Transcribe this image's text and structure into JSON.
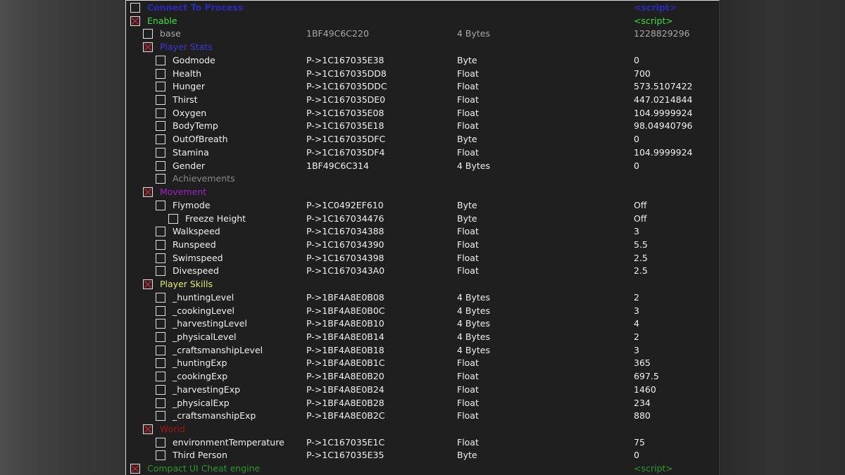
{
  "cheat_table": {
    "rows": [
      {
        "level": 0,
        "checked": false,
        "description": "Connect To Process",
        "address": "",
        "type": "",
        "value": "<script>",
        "desc_color": "#2a2ab8",
        "value_color": "#2a2ab8"
      },
      {
        "level": 0,
        "checked": true,
        "description": "Enable",
        "address": "",
        "type": "",
        "value": "<script>",
        "desc_color": "#3ce03c",
        "value_color": "#3ce03c"
      },
      {
        "level": 1,
        "checked": false,
        "description": "base",
        "address": "1BF49C6C220",
        "type": "4 Bytes",
        "value": "1228829296",
        "desc_color": "#a8a8a8",
        "value_color": "#a8a8a8",
        "addr_color": "#a8a8a8",
        "type_color": "#a8a8a8"
      },
      {
        "level": 1,
        "checked": true,
        "description": "Player Stats",
        "address": "",
        "type": "",
        "value": "",
        "desc_color": "#3a3ad8"
      },
      {
        "level": 2,
        "checked": false,
        "description": "Godmode",
        "address": "P->1C167035E38",
        "type": "Byte",
        "value": "0"
      },
      {
        "level": 2,
        "checked": false,
        "description": "Health",
        "address": "P->1C167035DD8",
        "type": "Float",
        "value": "700"
      },
      {
        "level": 2,
        "checked": false,
        "description": "Hunger",
        "address": "P->1C167035DDC",
        "type": "Float",
        "value": "573.5107422"
      },
      {
        "level": 2,
        "checked": false,
        "description": "Thirst",
        "address": "P->1C167035DE0",
        "type": "Float",
        "value": "447.0214844"
      },
      {
        "level": 2,
        "checked": false,
        "description": "Oxygen",
        "address": "P->1C167035E08",
        "type": "Float",
        "value": "104.9999924"
      },
      {
        "level": 2,
        "checked": false,
        "description": "BodyTemp",
        "address": "P->1C167035E18",
        "type": "Float",
        "value": "98.04940796"
      },
      {
        "level": 2,
        "checked": false,
        "description": "OutOfBreath",
        "address": "P->1C167035DFC",
        "type": "Byte",
        "value": "0"
      },
      {
        "level": 2,
        "checked": false,
        "description": "Stamina",
        "address": "P->1C167035DF4",
        "type": "Float",
        "value": "104.9999924"
      },
      {
        "level": 2,
        "checked": false,
        "description": "Gender",
        "address": "1BF49C6C314",
        "type": "4 Bytes",
        "value": "0"
      },
      {
        "level": 2,
        "checked": false,
        "description": "Achievements",
        "address": "",
        "type": "",
        "value": "",
        "desc_color": "#8a8a8a"
      },
      {
        "level": 1,
        "checked": true,
        "description": "Movement",
        "address": "",
        "type": "",
        "value": "",
        "desc_color": "#a020c0"
      },
      {
        "level": 2,
        "checked": false,
        "description": "Flymode",
        "address": "P->1C0492EF610",
        "type": "Byte",
        "value": "Off"
      },
      {
        "level": 3,
        "checked": false,
        "description": "Freeze Height",
        "address": "P->1C167034476",
        "type": "Byte",
        "value": "Off"
      },
      {
        "level": 2,
        "checked": false,
        "description": "Walkspeed",
        "address": "P->1C167034388",
        "type": "Float",
        "value": "3"
      },
      {
        "level": 2,
        "checked": false,
        "description": "Runspeed",
        "address": "P->1C167034390",
        "type": "Float",
        "value": "5.5"
      },
      {
        "level": 2,
        "checked": false,
        "description": "Swimspeed",
        "address": "P->1C167034398",
        "type": "Float",
        "value": "2.5"
      },
      {
        "level": 2,
        "checked": false,
        "description": "Divespeed",
        "address": "P->1C1670343A0",
        "type": "Float",
        "value": "2.5"
      },
      {
        "level": 1,
        "checked": true,
        "description": "Player Skills",
        "address": "",
        "type": "",
        "value": "",
        "desc_color": "#e8e870"
      },
      {
        "level": 2,
        "checked": false,
        "description": "_huntingLevel",
        "address": "P->1BF4A8E0B08",
        "type": "4 Bytes",
        "value": "2"
      },
      {
        "level": 2,
        "checked": false,
        "description": "_cookingLevel",
        "address": "P->1BF4A8E0B0C",
        "type": "4 Bytes",
        "value": "3"
      },
      {
        "level": 2,
        "checked": false,
        "description": "_harvestingLevel",
        "address": "P->1BF4A8E0B10",
        "type": "4 Bytes",
        "value": "4"
      },
      {
        "level": 2,
        "checked": false,
        "description": "_physicalLevel",
        "address": "P->1BF4A8E0B14",
        "type": "4 Bytes",
        "value": "2"
      },
      {
        "level": 2,
        "checked": false,
        "description": "_craftsmanshipLevel",
        "address": "P->1BF4A8E0B18",
        "type": "4 Bytes",
        "value": "3"
      },
      {
        "level": 2,
        "checked": false,
        "description": "_huntingExp",
        "address": "P->1BF4A8E0B1C",
        "type": "Float",
        "value": "365"
      },
      {
        "level": 2,
        "checked": false,
        "description": "_cookingExp",
        "address": "P->1BF4A8E0B20",
        "type": "Float",
        "value": "697.5"
      },
      {
        "level": 2,
        "checked": false,
        "description": "_harvestingExp",
        "address": "P->1BF4A8E0B24",
        "type": "Float",
        "value": "1460"
      },
      {
        "level": 2,
        "checked": false,
        "description": "_physicalExp",
        "address": "P->1BF4A8E0B28",
        "type": "Float",
        "value": "234"
      },
      {
        "level": 2,
        "checked": false,
        "description": "_craftsmanshipExp",
        "address": "P->1BF4A8E0B2C",
        "type": "Float",
        "value": "880"
      },
      {
        "level": 1,
        "checked": true,
        "description": "World",
        "address": "",
        "type": "",
        "value": "",
        "desc_color": "#a01818"
      },
      {
        "level": 2,
        "checked": false,
        "description": "environmentTemperature",
        "address": "P->1C167035E1C",
        "type": "Float",
        "value": "75"
      },
      {
        "level": 2,
        "checked": false,
        "description": "Third Person",
        "address": "P->1C167035E35",
        "type": "Byte",
        "value": "0"
      },
      {
        "level": 0,
        "checked": true,
        "description": "Compact UI Cheat engine",
        "address": "",
        "type": "",
        "value": "<script>",
        "desc_color": "#2a9a2a",
        "value_color": "#2a9a2a"
      }
    ]
  }
}
